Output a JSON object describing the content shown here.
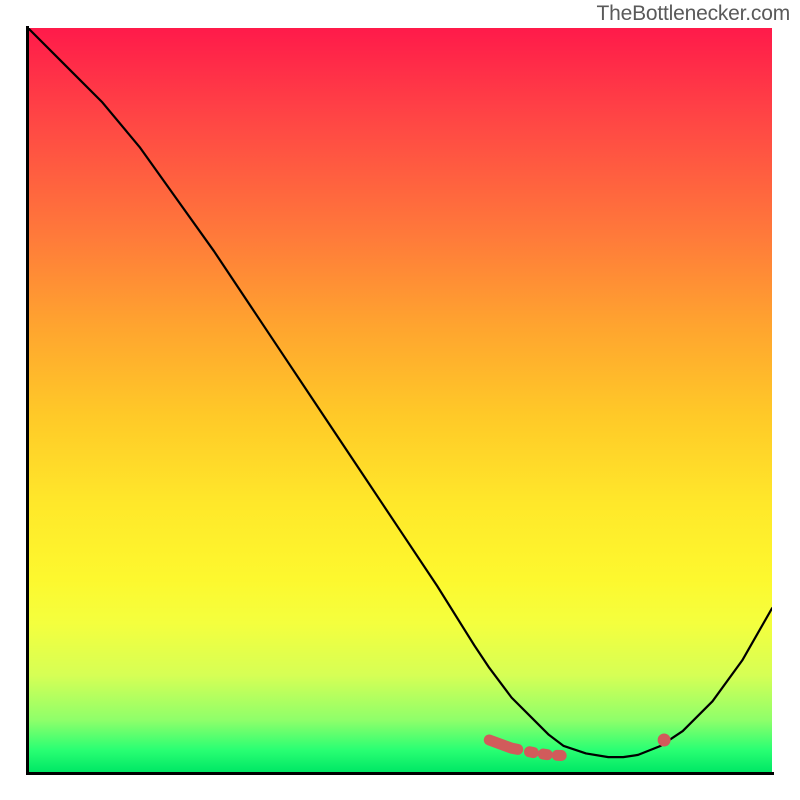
{
  "watermark": "TheBottlenecker.com",
  "chart_data": {
    "type": "line",
    "title": "",
    "xlabel": "",
    "ylabel": "",
    "xlim": [
      0,
      100
    ],
    "ylim": [
      0,
      100
    ],
    "grid": false,
    "series": [
      {
        "name": "curve",
        "x": [
          0,
          5,
          10,
          15,
          20,
          25,
          30,
          35,
          40,
          45,
          50,
          55,
          60,
          62,
          65,
          68,
          70,
          72,
          75,
          78,
          80,
          82,
          85,
          88,
          92,
          96,
          100
        ],
        "y": [
          100,
          95,
          90,
          84,
          77,
          70,
          62.5,
          55,
          47.5,
          40,
          32.5,
          25,
          17,
          14,
          10,
          7,
          5,
          3.5,
          2.5,
          2,
          2,
          2.3,
          3.5,
          5.5,
          9.5,
          15,
          22
        ]
      }
    ],
    "highlight_segment": {
      "x": [
        62,
        65,
        68,
        70,
        72,
        75,
        78,
        80,
        82
      ],
      "y": [
        4.3,
        3.2,
        2.6,
        2.3,
        2.2,
        2.2,
        2.2,
        2.3,
        3.0
      ]
    },
    "highlight_point": {
      "x": 85.5,
      "y": 4.3
    },
    "colors": {
      "curve": "#000000",
      "highlight": "#d15b5b",
      "gradient_top": "#ff1a4a",
      "gradient_bottom": "#00e765"
    }
  }
}
